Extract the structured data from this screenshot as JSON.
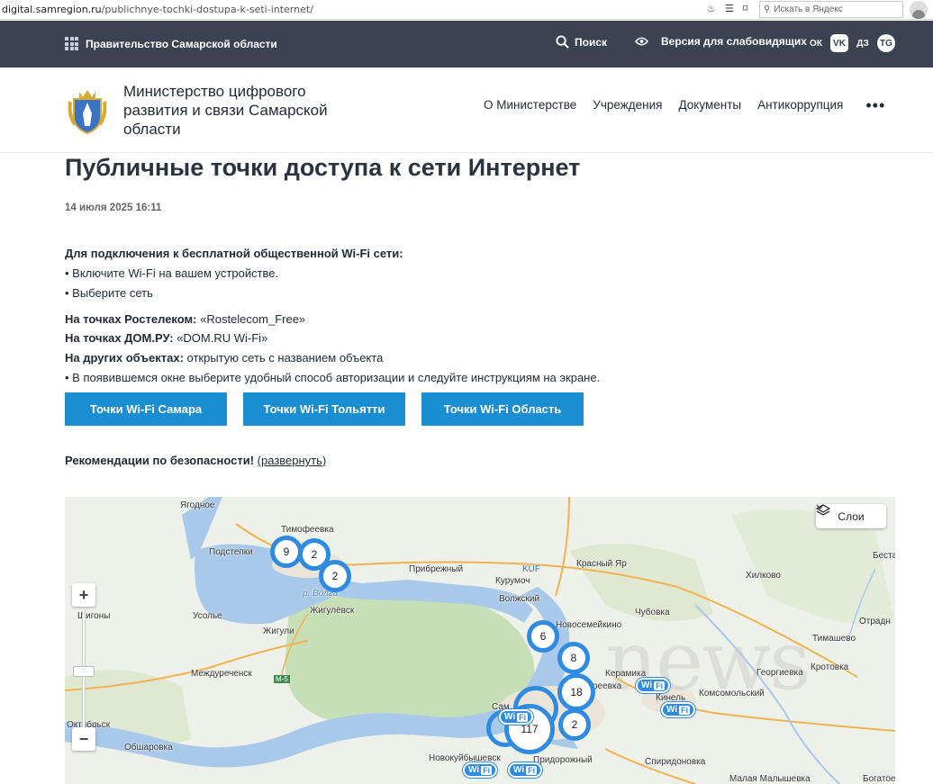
{
  "browser": {
    "url_domain": "digital.samregion.ru",
    "url_path": "/publichnye-tochki-dostupa-k-seti-internet/",
    "search_placeholder": "Искать в Яндекс"
  },
  "govbar": {
    "title": "Правительство Самарской области",
    "search_label": "Поиск",
    "accessibility_label": "Версия для слабовидящих",
    "social": [
      "ОК",
      "VK",
      "ДЗ",
      "TG"
    ]
  },
  "header": {
    "ministry": "Министерство цифрового развития и связи Самарской области",
    "nav": [
      "О Министерстве",
      "Учреждения",
      "Документы",
      "Антикоррупция"
    ],
    "more": "•••"
  },
  "article": {
    "title": "Публичные точки доступа к сети Интернет",
    "date": "14 июля 2025 16:11",
    "intro": "Для подключения к бесплатной общественной Wi-Fi сети:",
    "step1": "• Включите Wi-Fi на вашем устройстве.",
    "step2": "• Выберите сеть",
    "rt_label": "На точках Ростелеком:",
    "rt_value": " «Rostelecom_Free»",
    "dom_label": "На точках ДОМ.РУ:",
    "dom_value": " «DOM.RU Wi-Fi»",
    "other_label": "На других объектах:",
    "other_value": " открытую сеть с названием объекта",
    "step3": "• В появившемся окне выберите удобный способ авторизации и следуйте инструкциям на экране.",
    "buttons": [
      "Точки Wi-Fi Самара",
      "Точки Wi-Fi Тольятти",
      "Точки Wi-Fi Область"
    ],
    "security_label": "Рекомендации по безопасности!",
    "security_link": "(развернуть)"
  },
  "map": {
    "layers_label": "Слои",
    "zoom_in": "+",
    "zoom_out": "−",
    "wifi_label": "Wi",
    "wifi_badge": "Fi",
    "watermark": "news",
    "clusters": [
      "9",
      "2",
      "2",
      "6",
      "8",
      "18",
      "117",
      "2"
    ],
    "places": [
      "Ягодное",
      "Тимофеевка",
      "Подстепки",
      "Прибрежный",
      "Курумоч",
      "Красный Яр",
      "Хилково",
      "Волжский",
      "Новосемейкино",
      "Чубовка",
      "Жигулёвск",
      "Усолье",
      "Шигоны",
      "Жигули",
      "Тимашево",
      "Отрадн",
      "Междуреченск",
      "Керамика",
      "Георгиевка",
      "Кротовка",
      "Кинель",
      "Комсомольский",
      "Октябрьск",
      "Обшаровка",
      "Новокуйбышевск",
      "Придорожный",
      "Спиридоновка",
      "Малая Малышевка",
      "Богатое",
      "Бестатово",
      "KUF",
      "М-5",
      "р. Волга",
      "Сам",
      "реевка"
    ]
  }
}
